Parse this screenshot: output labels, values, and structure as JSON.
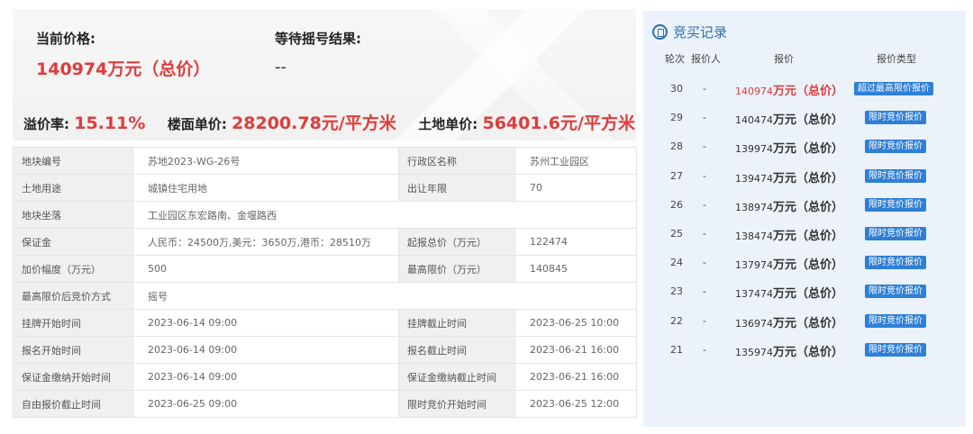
{
  "summary": {
    "current_price_label": "当前价格:",
    "current_price_value": "140974万元（总价）",
    "lottery_label": "等待摇号结果:",
    "lottery_value": "--",
    "premium_label": "溢价率:",
    "premium_value": "15.11%",
    "floor_price_label": "楼面单价:",
    "floor_price_value": "28200.78元/平方米",
    "land_price_label": "土地单价:",
    "land_price_value": "56401.6元/平方米"
  },
  "info": {
    "plot_no_k": "地块编号",
    "plot_no_v": "苏地2023-WG-26号",
    "district_k": "行政区名称",
    "district_v": "苏州工业园区",
    "usage_k": "土地用途",
    "usage_v": "城镇住宅用地",
    "term_k": "出让年限",
    "term_v": "70",
    "location_k": "地块坐落",
    "location_v": "工业园区东宏路南、金堰路西",
    "deposit_k": "保证金",
    "deposit_v": "人民币：24500万,美元：3650万,港币：28510万",
    "start_price_k": "起报总价（万元）",
    "start_price_v": "122474",
    "increment_k": "加价幅度（万元）",
    "increment_v": "500",
    "max_price_k": "最高限价（万元）",
    "max_price_v": "140845",
    "method_k": "最高限价后竞价方式",
    "method_v": "摇号",
    "list_start_k": "挂牌开始时间",
    "list_start_v": "2023-06-14 09:00",
    "list_end_k": "挂牌截止时间",
    "list_end_v": "2023-06-25 10:00",
    "reg_start_k": "报名开始时间",
    "reg_start_v": "2023-06-14 09:00",
    "reg_end_k": "报名截止时间",
    "reg_end_v": "2023-06-21 16:00",
    "dep_start_k": "保证金缴纳开始时间",
    "dep_start_v": "2023-06-14 09:00",
    "dep_end_k": "保证金缴纳截止时间",
    "dep_end_v": "2023-06-21 16:00",
    "free_end_k": "自由报价截止时间",
    "free_end_v": "2023-06-25 09:00",
    "limit_start_k": "限时竞价开始时间",
    "limit_start_v": "2023-06-25 12:00"
  },
  "bids": {
    "title": "竞买记录",
    "col_round": "轮次",
    "col_bidder": "报价人",
    "col_price": "报价",
    "col_type": "报价类型",
    "unit": "万元（总价）",
    "rows": [
      {
        "round": "30",
        "bidder": "-",
        "price": "140974",
        "type": "超过最高限价报价"
      },
      {
        "round": "29",
        "bidder": "-",
        "price": "140474",
        "type": "限时竞价报价"
      },
      {
        "round": "28",
        "bidder": "-",
        "price": "139974",
        "type": "限时竞价报价"
      },
      {
        "round": "27",
        "bidder": "-",
        "price": "139474",
        "type": "限时竞价报价"
      },
      {
        "round": "26",
        "bidder": "-",
        "price": "138974",
        "type": "限时竞价报价"
      },
      {
        "round": "25",
        "bidder": "-",
        "price": "138474",
        "type": "限时竞价报价"
      },
      {
        "round": "24",
        "bidder": "-",
        "price": "137974",
        "type": "限时竞价报价"
      },
      {
        "round": "23",
        "bidder": "-",
        "price": "137474",
        "type": "限时竞价报价"
      },
      {
        "round": "22",
        "bidder": "-",
        "price": "136974",
        "type": "限时竞价报价"
      },
      {
        "round": "21",
        "bidder": "-",
        "price": "135974",
        "type": "限时竞价报价"
      }
    ]
  }
}
